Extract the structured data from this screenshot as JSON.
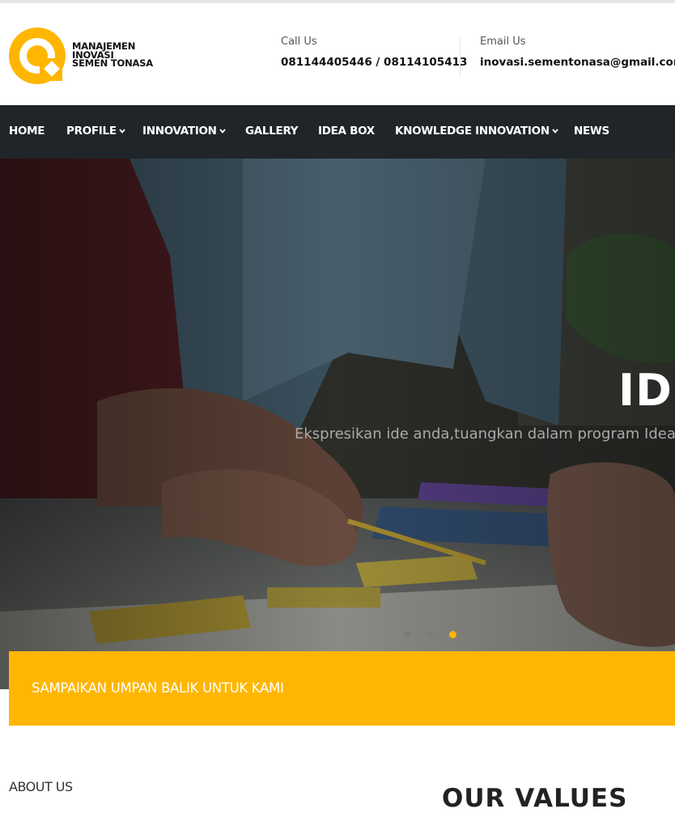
{
  "brand": {
    "logo_line1": "MANAJEMEN",
    "logo_line2": "INOVASI",
    "logo_line3": "SEMEN TONASA",
    "accent_color": "#ffb600",
    "nav_bg": "#202529"
  },
  "contacts": {
    "call": {
      "label": "Call Us",
      "value": "081144405446 / 08114105413"
    },
    "email": {
      "label": "Email Us",
      "value": "inovasi.sementonasa@gmail.com"
    }
  },
  "nav": {
    "items": [
      {
        "label": "HOME",
        "dropdown": false
      },
      {
        "label": "PROFILE",
        "dropdown": true
      },
      {
        "label": "INNOVATION",
        "dropdown": true
      },
      {
        "label": "GALLERY",
        "dropdown": false
      },
      {
        "label": "IDEA BOX",
        "dropdown": false
      },
      {
        "label": "KNOWLEDGE INNOVATION",
        "dropdown": true
      },
      {
        "label": "NEWS",
        "dropdown": false
      }
    ],
    "caret_icon": "chevron-down-icon"
  },
  "hero": {
    "title": "IDI",
    "subtitle": "Ekspresikan ide anda,tuangkan dalam program Ideabo",
    "slides_total": 3,
    "active_slide": 3
  },
  "feedback": {
    "label": "SAMPAIKAN UMPAN BALIK UNTUK KAMI"
  },
  "sections": {
    "about_label": "ABOUT US",
    "values_title": "OUR VALUES"
  }
}
